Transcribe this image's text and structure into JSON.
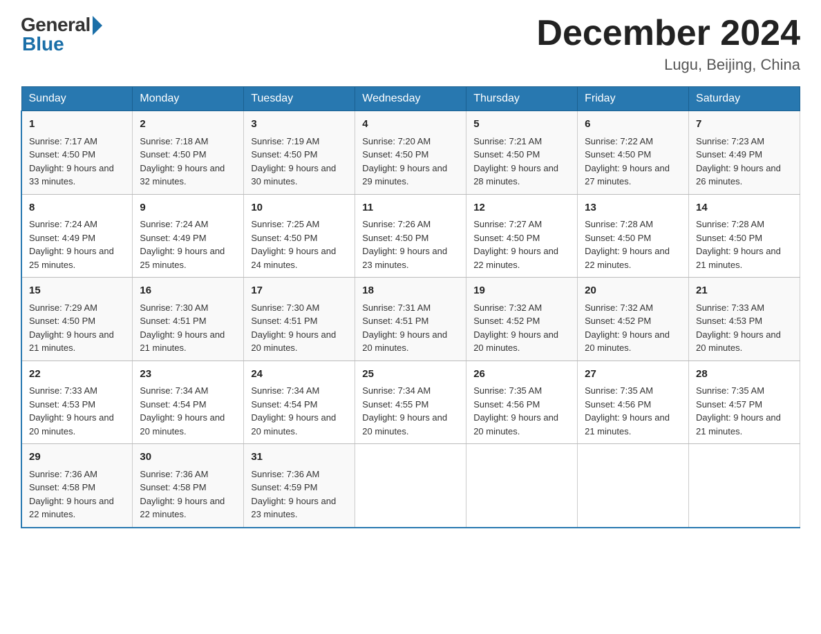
{
  "header": {
    "logo_general": "General",
    "logo_blue": "Blue",
    "month_title": "December 2024",
    "location": "Lugu, Beijing, China"
  },
  "days_of_week": [
    "Sunday",
    "Monday",
    "Tuesday",
    "Wednesday",
    "Thursday",
    "Friday",
    "Saturday"
  ],
  "weeks": [
    [
      {
        "num": "1",
        "sunrise": "7:17 AM",
        "sunset": "4:50 PM",
        "daylight": "9 hours and 33 minutes."
      },
      {
        "num": "2",
        "sunrise": "7:18 AM",
        "sunset": "4:50 PM",
        "daylight": "9 hours and 32 minutes."
      },
      {
        "num": "3",
        "sunrise": "7:19 AM",
        "sunset": "4:50 PM",
        "daylight": "9 hours and 30 minutes."
      },
      {
        "num": "4",
        "sunrise": "7:20 AM",
        "sunset": "4:50 PM",
        "daylight": "9 hours and 29 minutes."
      },
      {
        "num": "5",
        "sunrise": "7:21 AM",
        "sunset": "4:50 PM",
        "daylight": "9 hours and 28 minutes."
      },
      {
        "num": "6",
        "sunrise": "7:22 AM",
        "sunset": "4:50 PM",
        "daylight": "9 hours and 27 minutes."
      },
      {
        "num": "7",
        "sunrise": "7:23 AM",
        "sunset": "4:49 PM",
        "daylight": "9 hours and 26 minutes."
      }
    ],
    [
      {
        "num": "8",
        "sunrise": "7:24 AM",
        "sunset": "4:49 PM",
        "daylight": "9 hours and 25 minutes."
      },
      {
        "num": "9",
        "sunrise": "7:24 AM",
        "sunset": "4:49 PM",
        "daylight": "9 hours and 25 minutes."
      },
      {
        "num": "10",
        "sunrise": "7:25 AM",
        "sunset": "4:50 PM",
        "daylight": "9 hours and 24 minutes."
      },
      {
        "num": "11",
        "sunrise": "7:26 AM",
        "sunset": "4:50 PM",
        "daylight": "9 hours and 23 minutes."
      },
      {
        "num": "12",
        "sunrise": "7:27 AM",
        "sunset": "4:50 PM",
        "daylight": "9 hours and 22 minutes."
      },
      {
        "num": "13",
        "sunrise": "7:28 AM",
        "sunset": "4:50 PM",
        "daylight": "9 hours and 22 minutes."
      },
      {
        "num": "14",
        "sunrise": "7:28 AM",
        "sunset": "4:50 PM",
        "daylight": "9 hours and 21 minutes."
      }
    ],
    [
      {
        "num": "15",
        "sunrise": "7:29 AM",
        "sunset": "4:50 PM",
        "daylight": "9 hours and 21 minutes."
      },
      {
        "num": "16",
        "sunrise": "7:30 AM",
        "sunset": "4:51 PM",
        "daylight": "9 hours and 21 minutes."
      },
      {
        "num": "17",
        "sunrise": "7:30 AM",
        "sunset": "4:51 PM",
        "daylight": "9 hours and 20 minutes."
      },
      {
        "num": "18",
        "sunrise": "7:31 AM",
        "sunset": "4:51 PM",
        "daylight": "9 hours and 20 minutes."
      },
      {
        "num": "19",
        "sunrise": "7:32 AM",
        "sunset": "4:52 PM",
        "daylight": "9 hours and 20 minutes."
      },
      {
        "num": "20",
        "sunrise": "7:32 AM",
        "sunset": "4:52 PM",
        "daylight": "9 hours and 20 minutes."
      },
      {
        "num": "21",
        "sunrise": "7:33 AM",
        "sunset": "4:53 PM",
        "daylight": "9 hours and 20 minutes."
      }
    ],
    [
      {
        "num": "22",
        "sunrise": "7:33 AM",
        "sunset": "4:53 PM",
        "daylight": "9 hours and 20 minutes."
      },
      {
        "num": "23",
        "sunrise": "7:34 AM",
        "sunset": "4:54 PM",
        "daylight": "9 hours and 20 minutes."
      },
      {
        "num": "24",
        "sunrise": "7:34 AM",
        "sunset": "4:54 PM",
        "daylight": "9 hours and 20 minutes."
      },
      {
        "num": "25",
        "sunrise": "7:34 AM",
        "sunset": "4:55 PM",
        "daylight": "9 hours and 20 minutes."
      },
      {
        "num": "26",
        "sunrise": "7:35 AM",
        "sunset": "4:56 PM",
        "daylight": "9 hours and 20 minutes."
      },
      {
        "num": "27",
        "sunrise": "7:35 AM",
        "sunset": "4:56 PM",
        "daylight": "9 hours and 21 minutes."
      },
      {
        "num": "28",
        "sunrise": "7:35 AM",
        "sunset": "4:57 PM",
        "daylight": "9 hours and 21 minutes."
      }
    ],
    [
      {
        "num": "29",
        "sunrise": "7:36 AM",
        "sunset": "4:58 PM",
        "daylight": "9 hours and 22 minutes."
      },
      {
        "num": "30",
        "sunrise": "7:36 AM",
        "sunset": "4:58 PM",
        "daylight": "9 hours and 22 minutes."
      },
      {
        "num": "31",
        "sunrise": "7:36 AM",
        "sunset": "4:59 PM",
        "daylight": "9 hours and 23 minutes."
      },
      null,
      null,
      null,
      null
    ]
  ]
}
